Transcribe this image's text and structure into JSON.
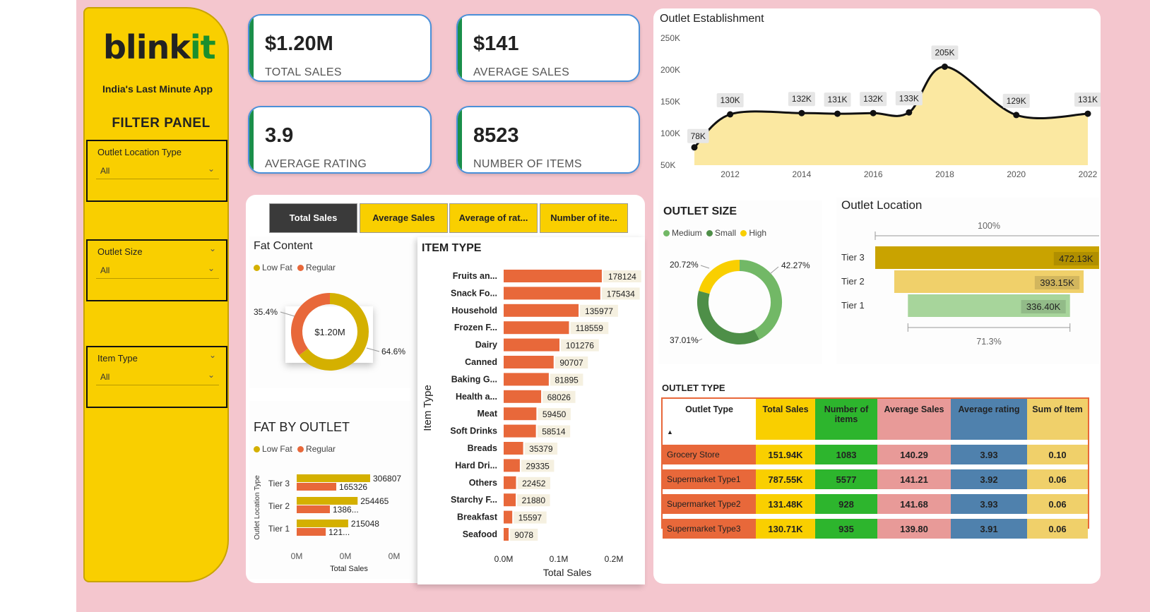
{
  "brand": {
    "logo_main": "blink",
    "logo_accent": "it",
    "tagline": "India's Last Minute App"
  },
  "filter_panel": {
    "title": "FILTER PANEL",
    "filters": [
      {
        "label": "Outlet Location Type",
        "value": "All"
      },
      {
        "label": "Outlet Size",
        "value": "All"
      },
      {
        "label": "Item Type",
        "value": "All"
      }
    ]
  },
  "kpis": [
    {
      "value": "$1.20M",
      "label": "TOTAL SALES"
    },
    {
      "value": "$141",
      "label": "AVERAGE SALES"
    },
    {
      "value": "3.9",
      "label": "AVERAGE RATING"
    },
    {
      "value": "8523",
      "label": "NUMBER OF ITEMS"
    }
  ],
  "measure_tabs": [
    "Total Sales",
    "Average Sales",
    "Average of rat...",
    "Number of ite..."
  ],
  "colors": {
    "gold": "#d4b000",
    "orange": "#e8683a",
    "yellow": "#f9cf00",
    "green_dark": "#4e8f48",
    "green_mid": "#72b866",
    "tier_gold": "#c9a300",
    "tier_light": "#f0d06a",
    "tier_green": "#a7d59b"
  },
  "chart_data": [
    {
      "id": "outlet_establishment",
      "type": "area",
      "title": "Outlet Establishment",
      "x": [
        2011,
        2012,
        2014,
        2015,
        2016,
        2017,
        2018,
        2020,
        2022
      ],
      "values": [
        78,
        130,
        132,
        131,
        132,
        133,
        205,
        129,
        131
      ],
      "value_labels": [
        "78K",
        "130K",
        "132K",
        "131K",
        "132K",
        "133K",
        "205K",
        "129K",
        "131K"
      ],
      "x_ticks": [
        "2012",
        "2014",
        "2016",
        "2018",
        "2020",
        "2022"
      ],
      "y_ticks": [
        "50K",
        "100K",
        "150K",
        "200K",
        "250K"
      ],
      "ylim": [
        50,
        250
      ]
    },
    {
      "id": "fat_content",
      "type": "pie",
      "title": "Fat Content",
      "center_label": "$1.20M",
      "series": [
        {
          "name": "Low Fat",
          "value": 64.6,
          "label": "64.6%"
        },
        {
          "name": "Regular",
          "value": 35.4,
          "label": "35.4%"
        }
      ]
    },
    {
      "id": "item_type",
      "type": "bar",
      "title": "ITEM TYPE",
      "xlabel": "Total Sales",
      "ylabel": "Item Type",
      "categories": [
        "Fruits an...",
        "Snack Fo...",
        "Household",
        "Frozen F...",
        "Dairy",
        "Canned",
        "Baking G...",
        "Health a...",
        "Meat",
        "Soft Drinks",
        "Breads",
        "Hard Dri...",
        "Others",
        "Starchy F...",
        "Breakfast",
        "Seafood"
      ],
      "values": [
        178124,
        175434,
        135977,
        118559,
        101276,
        90707,
        81895,
        68026,
        59450,
        58514,
        35379,
        29335,
        22452,
        21880,
        15597,
        9078
      ],
      "x_ticks": [
        "0.0M",
        "0.1M",
        "0.2M"
      ],
      "xlim": [
        0,
        200000
      ]
    },
    {
      "id": "outlet_size",
      "type": "pie",
      "title": "OUTLET SIZE",
      "series": [
        {
          "name": "Medium",
          "value": 42.27,
          "label": "42.27%"
        },
        {
          "name": "Small",
          "value": 37.01,
          "label": "37.01%"
        },
        {
          "name": "High",
          "value": 20.72,
          "label": "20.72%"
        }
      ]
    },
    {
      "id": "outlet_location",
      "type": "bar",
      "title": "Outlet Location",
      "categories": [
        "Tier 3",
        "Tier 2",
        "Tier 1"
      ],
      "values": [
        472.13,
        393.15,
        336.4
      ],
      "value_labels": [
        "472.13K",
        "393.15K",
        "336.40K"
      ],
      "top_label": "100%",
      "bottom_label": "71.3%"
    },
    {
      "id": "fat_by_outlet",
      "type": "bar",
      "title": "FAT BY OUTLET",
      "xlabel": "Total Sales",
      "ylabel": "Outlet Location Type",
      "categories": [
        "Tier 3",
        "Tier 2",
        "Tier 1"
      ],
      "series": [
        {
          "name": "Low Fat",
          "values": [
            306807,
            254465,
            215048
          ],
          "labels": [
            "306807",
            "254465",
            "215048"
          ]
        },
        {
          "name": "Regular",
          "values": [
            165326,
            138671,
            121349
          ],
          "labels": [
            "165326",
            "1386...",
            "121..."
          ]
        }
      ],
      "x_ticks": [
        "0M",
        "0M",
        "0M"
      ]
    },
    {
      "id": "outlet_type",
      "type": "table",
      "title": "OUTLET TYPE",
      "columns": [
        "Outlet Type",
        "Total Sales",
        "Number of items",
        "Average Sales",
        "Average rating",
        "Sum of Item"
      ],
      "rows": [
        [
          "Grocery Store",
          "151.94K",
          "1083",
          "140.29",
          "3.93",
          "0.10"
        ],
        [
          "Supermarket Type1",
          "787.55K",
          "5577",
          "141.21",
          "3.92",
          "0.06"
        ],
        [
          "Supermarket Type2",
          "131.48K",
          "928",
          "141.68",
          "3.93",
          "0.06"
        ],
        [
          "Supermarket Type3",
          "130.71K",
          "935",
          "139.80",
          "3.91",
          "0.06"
        ]
      ]
    }
  ]
}
